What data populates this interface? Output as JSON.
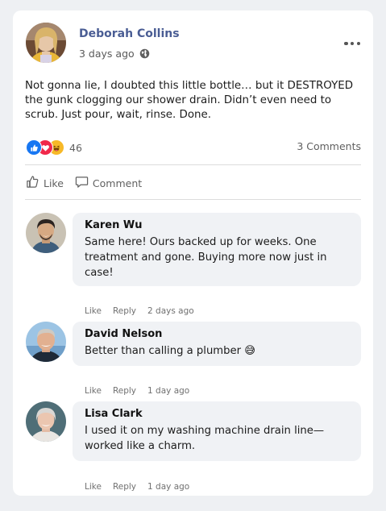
{
  "post": {
    "author": "Deborah Collins",
    "time": "3 days ago",
    "text": "Not gonna lie, I doubted this little bottle… but it DESTROYED the gunk clogging our shower drain. Didn’t even need to scrub. Just pour, wait, rinse. Done.",
    "reaction_count": "46",
    "comments_count": "3 Comments",
    "actions": {
      "like": "Like",
      "comment": "Comment"
    }
  },
  "comments": [
    {
      "name": "Karen Wu",
      "text": "Same here! Ours backed up for weeks. One treatment and gone. Buying more now just in case!",
      "like": "Like",
      "reply": "Reply",
      "time": "2 days ago"
    },
    {
      "name": "David Nelson",
      "text": "Better than calling a plumber 😅",
      "like": "Like",
      "reply": "Reply",
      "time": "1 day ago"
    },
    {
      "name": "Lisa Clark",
      "text": "I used it on my washing machine drain line—worked like a charm.",
      "like": "Like",
      "reply": "Reply",
      "time": "1 day ago"
    }
  ],
  "colors": {
    "author_name": "#4a5d94",
    "like_reaction": "#1877f2",
    "love_reaction": "#f0284a",
    "haha_reaction": "#f7b928"
  },
  "icons": [
    "globe-icon",
    "more-options-icon",
    "like-reaction-icon",
    "love-reaction-icon",
    "haha-reaction-icon",
    "thumbs-up-icon",
    "comment-bubble-icon"
  ]
}
